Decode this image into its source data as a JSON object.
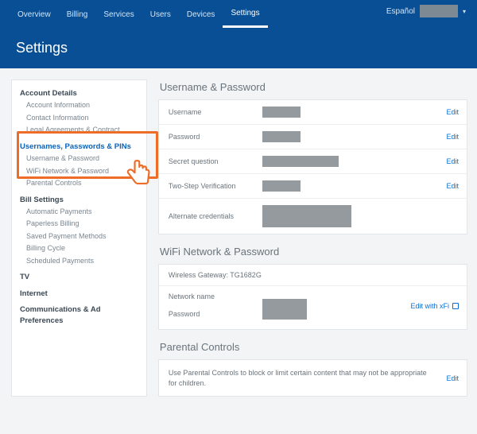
{
  "nav": {
    "tabs": [
      "Overview",
      "Billing",
      "Services",
      "Users",
      "Devices",
      "Settings"
    ],
    "active_index": 5,
    "language": "Español"
  },
  "page": {
    "title": "Settings"
  },
  "sidebar": {
    "groups": [
      {
        "label": "Account Details",
        "items": [
          "Account Information",
          "Contact Information",
          "Legal Agreements & Contract"
        ]
      },
      {
        "label": "Usernames, Passwords & PINs",
        "highlight": true,
        "items": [
          "Username & Password",
          "WiFi Network & Password",
          "Parental Controls"
        ]
      },
      {
        "label": "Bill Settings",
        "items": [
          "Automatic Payments",
          "Paperless Billing",
          "Saved Payment Methods",
          "Billing Cycle",
          "Scheduled Payments"
        ]
      },
      {
        "label": "TV",
        "items": []
      },
      {
        "label": "Internet",
        "items": []
      },
      {
        "label": "Communications & Ad Preferences",
        "items": []
      }
    ]
  },
  "sections": {
    "username_password": {
      "title": "Username & Password",
      "rows": {
        "username": {
          "label": "Username",
          "action": "Edit"
        },
        "password": {
          "label": "Password",
          "action": "Edit"
        },
        "secret_question": {
          "label": "Secret question",
          "action": "Edit"
        },
        "two_step": {
          "label": "Two-Step Verification",
          "action": "Edit"
        },
        "alternate": {
          "label": "Alternate credentials"
        }
      }
    },
    "wifi": {
      "title": "WiFi Network & Password",
      "gateway_label": "Wireless Gateway:",
      "gateway_value": "TG1682G",
      "network_label": "Network name",
      "password_label": "Password",
      "action": "Edit with xFi"
    },
    "parental": {
      "title": "Parental Controls",
      "text": "Use Parental Controls to block or limit certain content that may not be appropriate for children.",
      "action": "Edit"
    }
  }
}
